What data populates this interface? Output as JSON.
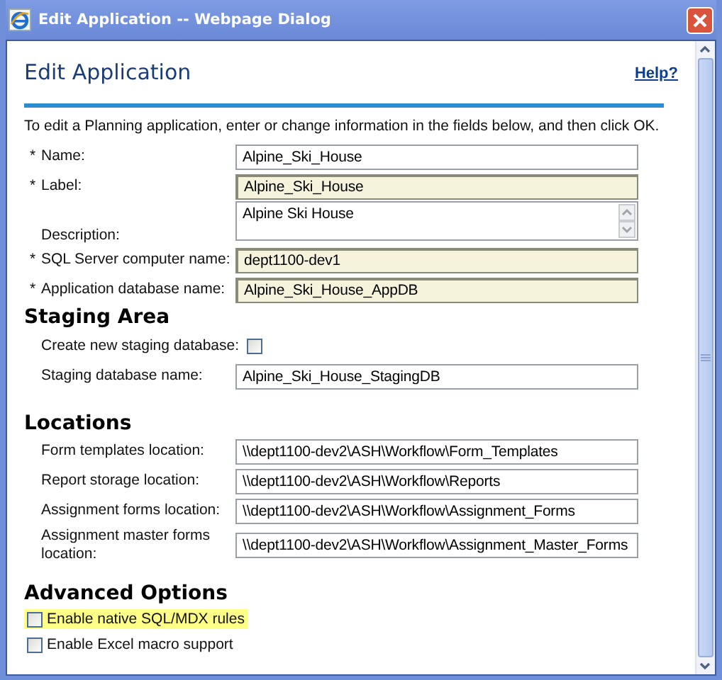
{
  "window": {
    "title": "Edit Application -- Webpage Dialog"
  },
  "heading": "Edit Application",
  "help_link": "Help?",
  "instructions": "To edit a Planning application, enter or change information in the fields below, and then click OK.",
  "fields": [
    {
      "marker": "*",
      "label": "Name:",
      "value": "Alpine_Ski_House",
      "readonly": false,
      "kind": "text"
    },
    {
      "marker": "*",
      "label": "Label:",
      "value": "Alpine_Ski_House",
      "readonly": true,
      "kind": "text"
    },
    {
      "label": "Description:",
      "value": "Alpine Ski House",
      "readonly": false,
      "kind": "textarea"
    },
    {
      "marker": "*",
      "label": "SQL Server computer name:",
      "value": "dept1100-dev1",
      "readonly": true,
      "kind": "text"
    },
    {
      "marker": "*",
      "label": "Application database name:",
      "value": "Alpine_Ski_House_AppDB",
      "readonly": true,
      "kind": "text"
    }
  ],
  "staging_area": {
    "title": "Staging Area",
    "create_new": {
      "label": "Create new staging database:",
      "checked": false
    },
    "fields": [
      {
        "label": "Staging database name:",
        "value": "Alpine_Ski_House_StagingDB",
        "readonly": false
      }
    ]
  },
  "locations": {
    "title": "Locations",
    "fields": [
      {
        "label": "Form templates location:",
        "value": "\\\\dept1100-dev2\\ASH\\Workflow\\Form_Templates",
        "readonly": false
      },
      {
        "label": "Report storage location:",
        "value": "\\\\dept1100-dev2\\ASH\\Workflow\\Reports",
        "readonly": false
      },
      {
        "label": "Assignment forms location:",
        "value": "\\\\dept1100-dev2\\ASH\\Workflow\\Assignment_Forms",
        "readonly": false
      },
      {
        "label": "Assignment master forms location:",
        "value": "\\\\dept1100-dev2\\ASH\\Workflow\\Assignment_Master_Forms",
        "readonly": false
      }
    ]
  },
  "advanced_options": {
    "title": "Advanced Options",
    "options": [
      {
        "label": "Enable native SQL/MDX rules",
        "checked": false,
        "highlighted": true
      },
      {
        "label": "Enable Excel macro support",
        "checked": false,
        "highlighted": false
      }
    ]
  }
}
